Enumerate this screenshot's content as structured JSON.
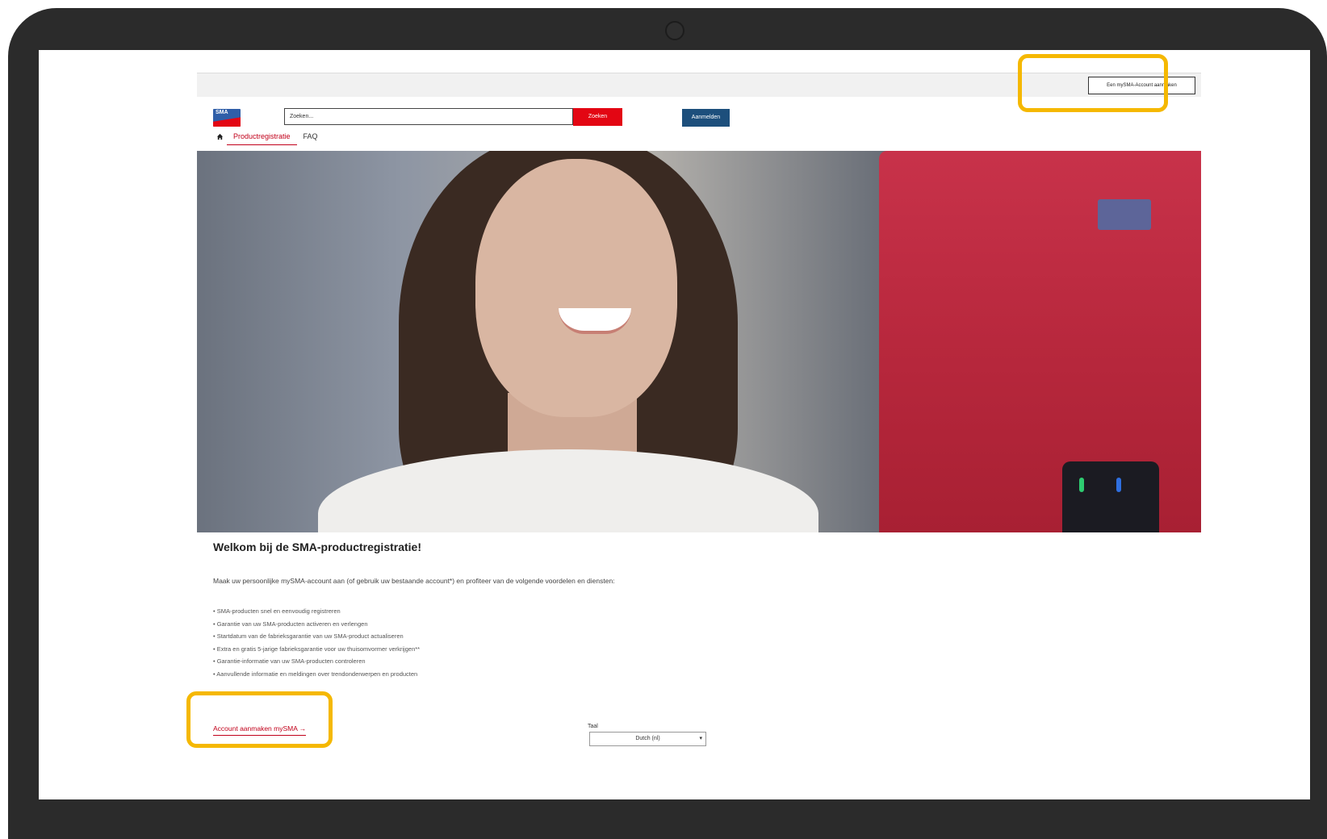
{
  "topbar": {
    "create_account_button": "Een mySMA-Account aanmaken"
  },
  "header": {
    "logo_text": "SMA",
    "search_placeholder": "Zoeken...",
    "search_button": "Zoeken",
    "login_button": "Aanmelden"
  },
  "nav": {
    "tabs": [
      {
        "label": "Productregistratie",
        "active": true
      },
      {
        "label": "FAQ",
        "active": false
      }
    ]
  },
  "main": {
    "title": "Welkom bij de SMA-productregistratie!",
    "intro": "Maak uw persoonlijke mySMA-account aan (of gebruik uw bestaande account*) en profiteer van de volgende voordelen en diensten:",
    "benefits": [
      "SMA-producten snel en eenvoudig registreren",
      "Garantie van uw SMA-producten activeren en verlengen",
      "Startdatum van de fabrieksgarantie van uw SMA-product actualiseren",
      "Extra en gratis 5-jarige fabrieksgarantie voor uw thuisomvormer verkrijgen**",
      "Garantie-informatie van uw SMA-producten controleren",
      "Aanvullende informatie en meldingen over trendonderwerpen en producten"
    ],
    "account_link": "Account aanmaken mySMA →"
  },
  "language": {
    "label": "Taal",
    "selected": "Dutch (nl)"
  },
  "colors": {
    "brand_red": "#e30613",
    "brand_blue": "#1d4f7c",
    "highlight": "#f5b800"
  }
}
